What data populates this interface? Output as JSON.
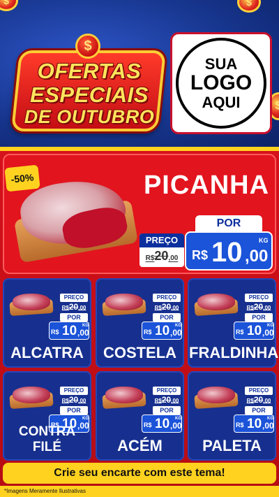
{
  "header": {
    "title_lines": [
      "OFERTAS",
      "ESPECIAIS",
      "DE OUTUBRO"
    ],
    "badge_symbol": "$",
    "logo_lines": [
      "SUA",
      "LOGO",
      "AQUI"
    ]
  },
  "hero": {
    "discount": "-50%",
    "product": "PICANHA",
    "old_label": "PREÇO",
    "old_price": "R$20,00",
    "old_int": "20",
    "old_dec": ",00",
    "new_label": "POR",
    "currency": "R$",
    "new_int": "10",
    "new_dec": ",00",
    "unit": "KG"
  },
  "products": [
    {
      "name": "ALCATRA",
      "old_label": "PREÇO",
      "old_int": "20",
      "old_dec": ",00",
      "new_label": "POR",
      "currency": "R$",
      "new_int": "10",
      "new_dec": ",00",
      "unit": "KG"
    },
    {
      "name": "COSTELA",
      "old_label": "PREÇO",
      "old_int": "20",
      "old_dec": ",00",
      "new_label": "POR",
      "currency": "R$",
      "new_int": "10",
      "new_dec": ",00",
      "unit": "KG"
    },
    {
      "name": "FRALDINHA",
      "old_label": "PREÇO",
      "old_int": "20",
      "old_dec": ",00",
      "new_label": "POR",
      "currency": "R$",
      "new_int": "10",
      "new_dec": ",00",
      "unit": "KG"
    },
    {
      "name": "CONTRA FILÉ",
      "old_label": "PREÇO",
      "old_int": "20",
      "old_dec": ",00",
      "new_label": "POR",
      "currency": "R$",
      "new_int": "10",
      "new_dec": ",00",
      "unit": "KG"
    },
    {
      "name": "ACÉM",
      "old_label": "PREÇO",
      "old_int": "20",
      "old_dec": ",00",
      "new_label": "POR",
      "currency": "R$",
      "new_int": "10",
      "new_dec": ",00",
      "unit": "KG"
    },
    {
      "name": "PALETA",
      "old_label": "PREÇO",
      "old_int": "20",
      "old_dec": ",00",
      "new_label": "POR",
      "currency": "R$",
      "new_int": "10",
      "new_dec": ",00",
      "unit": "KG"
    }
  ],
  "cta": "Crie seu encarte com este tema!",
  "footnote": "*Imagens Meramente Ilustrativas",
  "colors": {
    "red": "#d6111b",
    "blue": "#17308f",
    "yellow": "#ffd21f",
    "price_blue": "#1b53d9"
  }
}
